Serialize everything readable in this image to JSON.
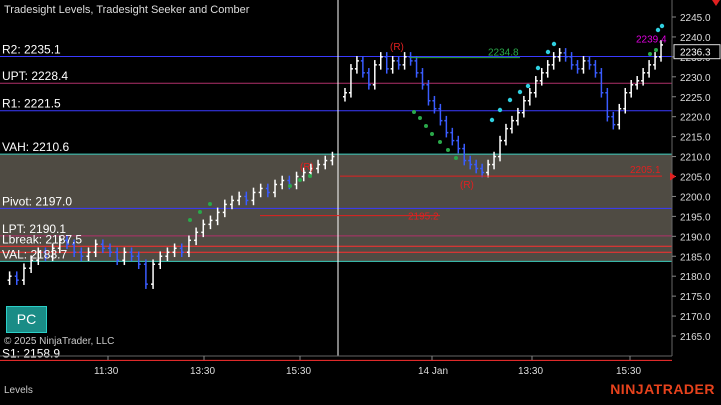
{
  "window": {
    "title": "Tradesight Levels, Tradesight Seeker and Comber",
    "copyright": "© 2025 NinjaTrader, LLC",
    "tab_label": "Levels",
    "brand": "NINJATRADER"
  },
  "pc_button": {
    "label": "PC"
  },
  "colors": {
    "background": "#000000",
    "r2": "#3a3aff",
    "upt": "#b0306a",
    "r1": "#3a3aff",
    "vah": "#3fd0c0",
    "value_area_fill": "#58534a",
    "pivot": "#3a3aff",
    "lpt": "#b0306a",
    "s_levels": "#ff3030",
    "val": "#3fd0c0",
    "bar_up": "#ffffff",
    "bar_down": "#3a5cff",
    "seeker_green": "#2aa84a",
    "seeker_cyan": "#30d0e0",
    "reset_red": "#e02020",
    "price_marker": "#e000e0",
    "session_divider": "#ffffff"
  },
  "levels": [
    {
      "id": "r2",
      "label": "R2: 2235.1",
      "price": 2235.1
    },
    {
      "id": "upt",
      "label": "UPT: 2228.4",
      "price": 2228.4
    },
    {
      "id": "r1",
      "label": "R1: 2221.5",
      "price": 2221.5
    },
    {
      "id": "vah",
      "label": "VAH: 2210.6",
      "price": 2210.6
    },
    {
      "id": "pivot",
      "label": "Pivot: 2197.0",
      "price": 2197.0
    },
    {
      "id": "lpt",
      "label": "LPT: 2190.1",
      "price": 2190.1
    },
    {
      "id": "lbreak",
      "label": "Lbreak: 2187.5",
      "price": 2187.5
    },
    {
      "id": "val",
      "label": "VAL: 2183.7",
      "price": 2183.7
    },
    {
      "id": "s1",
      "label": "S1: 2158.9",
      "price": 2158.9
    }
  ],
  "annotations": {
    "level_2234": "2234.8",
    "level_2205": "2205.1",
    "level_2195": "2195.2",
    "current_marker": "2239.4",
    "last_price": "2236.3",
    "reset_marks": [
      "(R)",
      "(R)",
      "(R)"
    ]
  },
  "chart_data": {
    "type": "candlestick",
    "y_axis": {
      "min": 2162,
      "max": 2249,
      "ticks": [
        "2245.0",
        "2240.0",
        "2235.0",
        "2230.0",
        "2225.0",
        "2220.0",
        "2215.0",
        "2210.0",
        "2205.0",
        "2200.0",
        "2195.0",
        "2190.0",
        "2185.0",
        "2180.0",
        "2175.0",
        "2170.0",
        "2165.0"
      ]
    },
    "x_axis": {
      "ticks": [
        "11:30",
        "13:30",
        "15:30",
        "14 Jan",
        "13:30",
        "15:30"
      ]
    },
    "session_1_closes": [
      2180,
      2179,
      2182,
      2184,
      2186,
      2185,
      2187,
      2189,
      2188,
      2186,
      2185,
      2186,
      2188,
      2187,
      2186,
      2184,
      2186,
      2185,
      2183,
      2178,
      2183,
      2185,
      2186,
      2187,
      2186,
      2189,
      2191,
      2193,
      2194,
      2196,
      2198,
      2199,
      2200,
      2199,
      2201,
      2202,
      2201,
      2203,
      2204,
      2203,
      2205,
      2206,
      2207,
      2208,
      2209,
      2210
    ],
    "session_2_closes": [
      2226,
      2232,
      2234,
      2231,
      2228,
      2233,
      2235,
      2232,
      2234,
      2233,
      2235,
      2234,
      2231,
      2228,
      2224,
      2222,
      2219,
      2216,
      2214,
      2212,
      2209,
      2208,
      2207,
      2206,
      2208,
      2210,
      2214,
      2217,
      2219,
      2221,
      2224,
      2226,
      2229,
      2231,
      2233,
      2235,
      2236,
      2235,
      2233,
      2232,
      2234,
      2233,
      2231,
      2226,
      2220,
      2218,
      2222,
      2226,
      2228,
      2229,
      2231,
      2233,
      2235,
      2238
    ]
  }
}
